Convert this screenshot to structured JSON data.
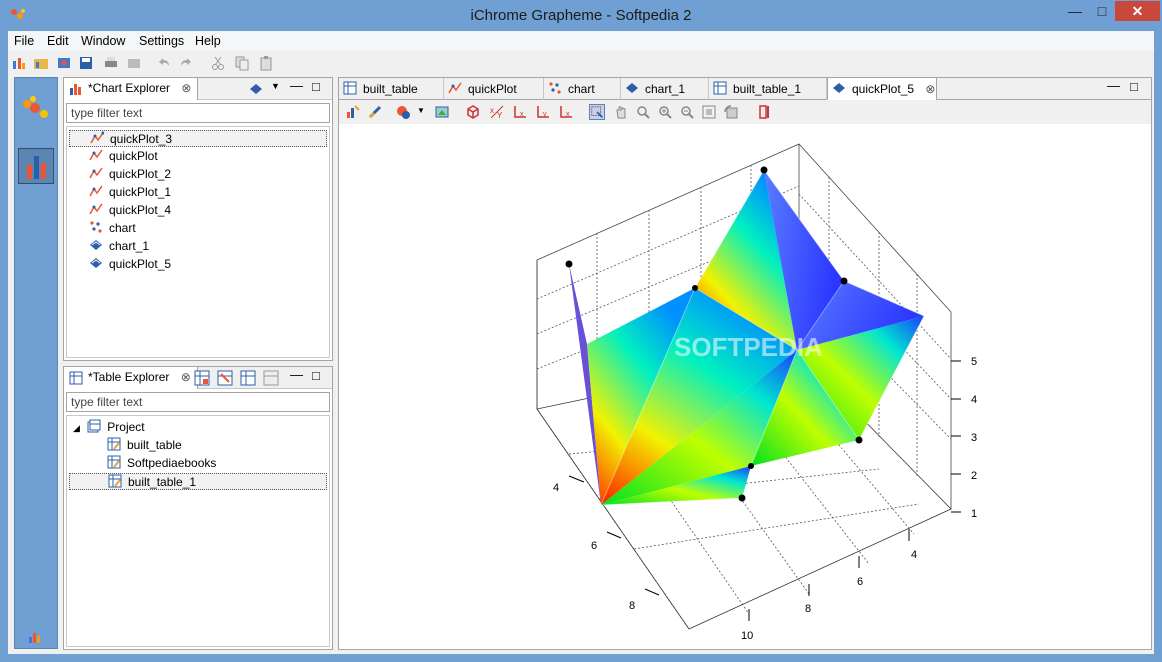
{
  "window": {
    "title": "iChrome Grapheme - Softpedia 2"
  },
  "menu": [
    "File",
    "Edit",
    "Window",
    "Settings",
    "Help"
  ],
  "chart_explorer": {
    "title": "*Chart Explorer",
    "filter_placeholder": "type filter text",
    "items": [
      "quickPlot_3",
      "quickPlot",
      "quickPlot_2",
      "quickPlot_1",
      "quickPlot_4",
      "chart",
      "chart_1",
      "quickPlot_5"
    ]
  },
  "table_explorer": {
    "title": "*Table Explorer",
    "filter_placeholder": "type filter text",
    "root": "Project",
    "items": [
      "built_table",
      "Softpediaebooks",
      "built_table_1"
    ]
  },
  "editor_tabs": [
    "built_table",
    "quickPlot",
    "chart",
    "chart_1",
    "built_table_1",
    "quickPlot_5"
  ],
  "plot": {
    "watermark": "SOFTPEDIA",
    "z_ticks": [
      "1",
      "2",
      "3",
      "4",
      "5"
    ],
    "x_ticks": [
      "4",
      "6",
      "8",
      "10"
    ],
    "y_ticks": [
      "4",
      "6",
      "8"
    ],
    "left_ticks": [
      "4",
      "6",
      "8"
    ]
  },
  "colors": {
    "accent": "#6f9fd3",
    "close": "#c9473b"
  }
}
